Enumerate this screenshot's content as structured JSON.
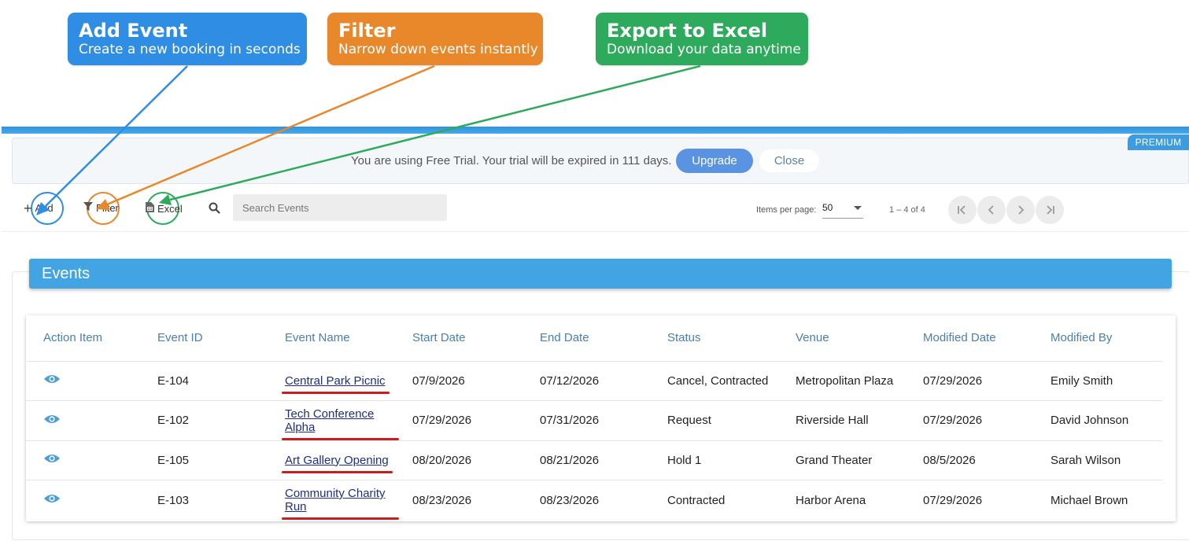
{
  "callouts": {
    "add": {
      "title": "Add Event",
      "subtitle": "Create a new booking in seconds",
      "color": "#2f8de4"
    },
    "filter": {
      "title": "Filter",
      "subtitle": "Narrow down events instantly",
      "color": "#e8882b"
    },
    "excel": {
      "title": "Export to Excel",
      "subtitle": "Download your data anytime",
      "color": "#2eaa5d"
    }
  },
  "badge": {
    "premium": "PREMIUM"
  },
  "trial": {
    "message": "You are using Free Trial. Your trial will be expired in 111 days.",
    "upgrade_label": "Upgrade",
    "close_label": "Close"
  },
  "toolbar": {
    "add_label": "Add",
    "filter_label": "Filter",
    "excel_label": "Excel",
    "search_placeholder": "Search Events",
    "items_per_page_label": "Items per page:",
    "items_per_page_value": "50",
    "range_label": "1 – 4 of 4"
  },
  "icons": {
    "add": "plus-icon",
    "filter": "filter-icon",
    "excel": "excel-file-icon",
    "search": "search-icon",
    "view": "eye-icon",
    "first": "first-page-icon",
    "prev": "prev-page-icon",
    "next": "next-page-icon",
    "last": "last-page-icon"
  },
  "events": {
    "title": "Events",
    "columns": [
      "Action Item",
      "Event ID",
      "Event Name",
      "Start Date",
      "End Date",
      "Status",
      "Venue",
      "Modified Date",
      "Modified By"
    ],
    "rows": [
      {
        "id": "E-104",
        "name": "Central Park Picnic",
        "start": "07/9/2026",
        "end": "07/12/2026",
        "status": "Cancel, Contracted",
        "venue": "Metropolitan Plaza",
        "modified": "07/29/2026",
        "by": "Emily Smith"
      },
      {
        "id": "E-102",
        "name": "Tech Conference Alpha",
        "start": "07/29/2026",
        "end": "07/31/2026",
        "status": "Request",
        "venue": "Riverside Hall",
        "modified": "07/29/2026",
        "by": "David Johnson"
      },
      {
        "id": "E-105",
        "name": "Art Gallery Opening",
        "start": "08/20/2026",
        "end": "08/21/2026",
        "status": "Hold 1",
        "venue": "Grand Theater",
        "modified": "08/5/2026",
        "by": "Sarah Wilson"
      },
      {
        "id": "E-103",
        "name": "Community Charity Run",
        "start": "08/23/2026",
        "end": "08/23/2026",
        "status": "Contracted",
        "venue": "Harbor Arena",
        "modified": "07/29/2026",
        "by": "Michael Brown"
      }
    ]
  },
  "colors": {
    "accent": "#42a4e3",
    "header_text": "#4a7fae",
    "link": "#1f2d86",
    "highlight_underline": "#c42020",
    "eye_icon": "#4a9fd6"
  }
}
